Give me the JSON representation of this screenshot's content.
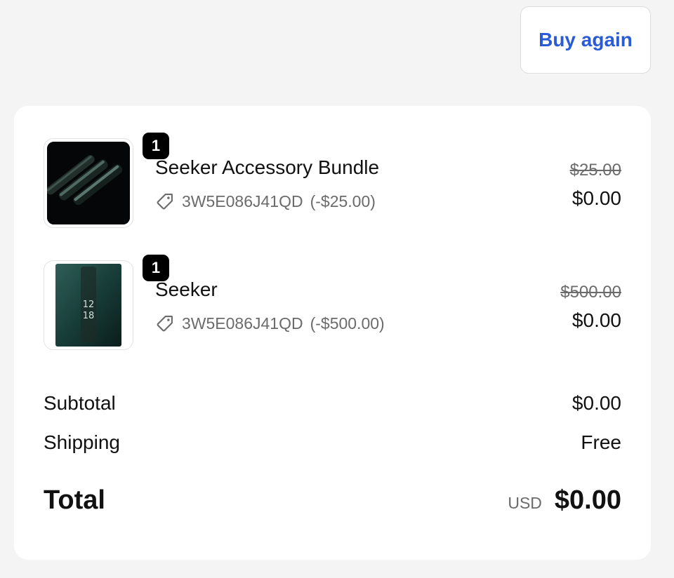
{
  "header": {
    "buy_again_label": "Buy again"
  },
  "items": [
    {
      "quantity": "1",
      "name": "Seeker Accessory Bundle",
      "discount_code": "3W5E086J41QD",
      "discount_amount": "(-$25.00)",
      "original_price": "$25.00",
      "final_price": "$0.00",
      "thumbnail": "dark-phones-product-image"
    },
    {
      "quantity": "1",
      "name": "Seeker",
      "discount_code": "3W5E086J41QD",
      "discount_amount": "(-$500.00)",
      "original_price": "$500.00",
      "final_price": "$0.00",
      "thumbnail": "seeker-phone-product-image",
      "thumbnail_clock": "12\n18"
    }
  ],
  "summary": {
    "subtotal_label": "Subtotal",
    "subtotal_value": "$0.00",
    "shipping_label": "Shipping",
    "shipping_value": "Free",
    "total_label": "Total",
    "currency": "USD",
    "total_value": "$0.00"
  },
  "colors": {
    "accent": "#2a5bd7",
    "page_bg": "#f4f4f4",
    "card_bg": "#ffffff",
    "muted_text": "#6b6b6b"
  }
}
